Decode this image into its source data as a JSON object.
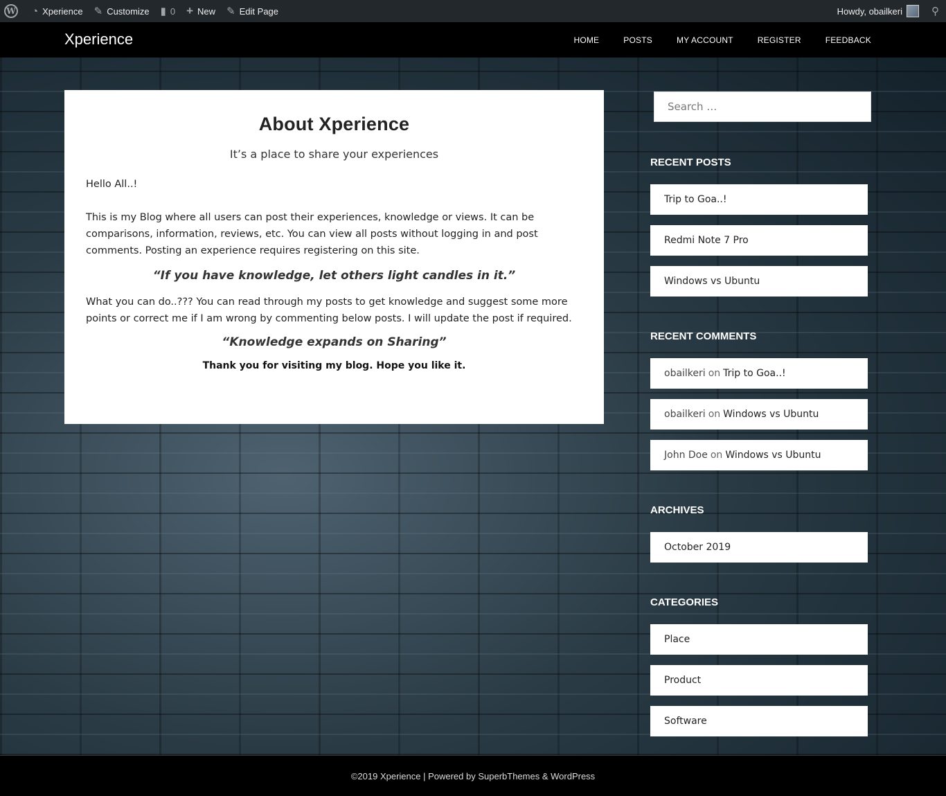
{
  "adminbar": {
    "site_name": "Xperience",
    "customize": "Customize",
    "comments_count": "0",
    "new": "New",
    "edit_page": "Edit Page",
    "howdy": "Howdy, obailkeri"
  },
  "header": {
    "site_title": "Xperience",
    "nav": [
      "HOME",
      "POSTS",
      "MY ACCOUNT",
      "REGISTER",
      "FEEDBACK"
    ]
  },
  "page": {
    "title": "About Xperience",
    "subtitle": "It’s a place to share your experiences",
    "hello": "Hello All..!",
    "body1": "This is my Blog where all users can post their experiences, knowledge or views. It can be comparisons, information, reviews, etc. You can view all posts without logging in and post comments. Posting an experience requires registering on this site.",
    "quote1": "“If you have knowledge, let others light candles in it.”",
    "body2": "What you can do..??? You can read through my posts to get knowledge and suggest some more points or correct me if I am wrong by commenting below posts. I will update the post if required.",
    "quote2": "“Knowledge expands on Sharing”",
    "thanks": "Thank you for visiting my blog. Hope you like it."
  },
  "sidebar": {
    "search_placeholder": "Search …",
    "recent_posts_title": "RECENT POSTS",
    "recent_posts": [
      "Trip to Goa..!",
      "Redmi Note 7 Pro",
      "Windows vs Ubuntu"
    ],
    "recent_comments_title": "RECENT COMMENTS",
    "recent_comments": [
      {
        "author": "obailkeri",
        "on": "on",
        "post": "Trip to Goa..!"
      },
      {
        "author": "obailkeri",
        "on": "on",
        "post": "Windows vs Ubuntu"
      },
      {
        "author": "John Doe",
        "on": "on",
        "post": "Windows vs Ubuntu"
      }
    ],
    "archives_title": "ARCHIVES",
    "archives": [
      "October 2019"
    ],
    "categories_title": "CATEGORIES",
    "categories": [
      "Place",
      "Product",
      "Software"
    ]
  },
  "footer": {
    "text": "©2019 Xperience | Powered by SuperbThemes & WordPress"
  }
}
